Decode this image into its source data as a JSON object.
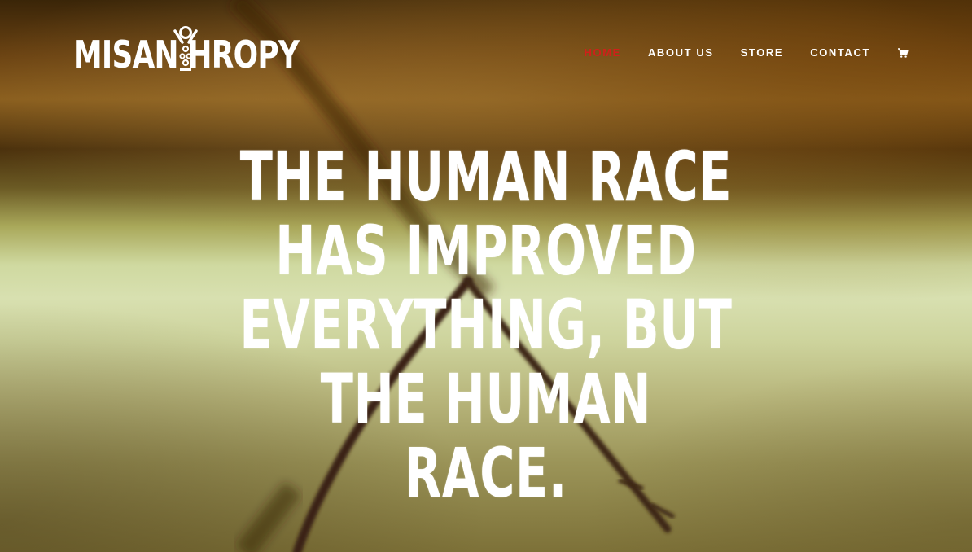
{
  "brand": {
    "logo_text": "MISAN HROPY",
    "logo_icon": "figure-emblem-icon"
  },
  "nav": {
    "items": [
      {
        "label": "HOME",
        "active": true
      },
      {
        "label": "ABOUT US",
        "active": false
      },
      {
        "label": "STORE",
        "active": false
      },
      {
        "label": "CONTACT",
        "active": false
      }
    ],
    "cart_icon": "cart-icon",
    "active_color": "#d0201a"
  },
  "hero": {
    "headline_lines": [
      "THE HUMAN RACE",
      "HAS IMPROVED",
      "EVERYTHING, BUT",
      "THE HUMAN",
      "RACE."
    ],
    "text_color": "#ffffff"
  }
}
